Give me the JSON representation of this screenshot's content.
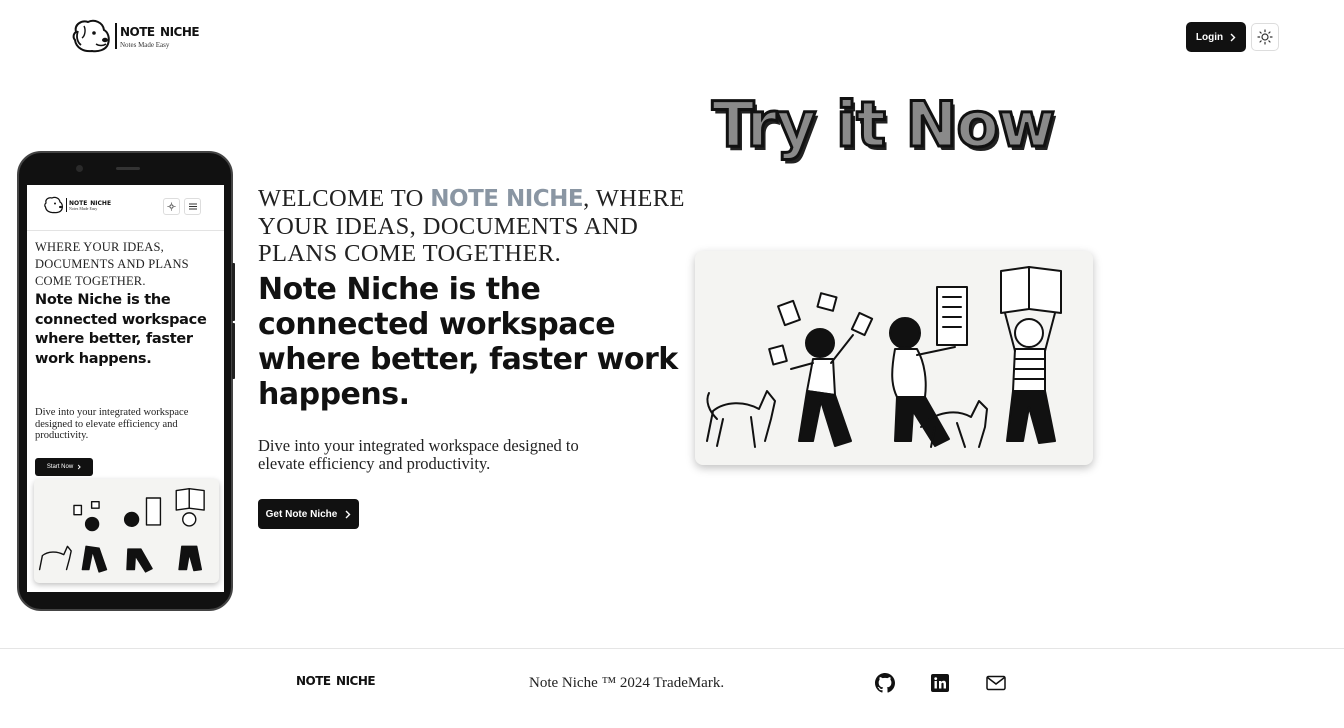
{
  "header": {
    "brand": "Note Niche",
    "tagline": "Notes Made Easy",
    "login_label": "Login",
    "theme_icon": "sun-icon"
  },
  "hero": {
    "try_now": "Try it Now",
    "welcome_prefix": "WELCOME TO",
    "welcome_brand": "NOTE NICHE",
    "welcome_suffix": ", WHERE YOUR IDEAS, DOCUMENTS AND PLANS COME TOGETHER.",
    "headline": "Note Niche is the connected workspace where better, faster work happens.",
    "description": "Dive into your integrated workspace designed to elevate efficiency and productivity.",
    "cta_label": "Get Note Niche"
  },
  "phone_preview": {
    "brand": "Note Niche",
    "tagline": "Notes Made Easy",
    "welcome": "WHERE YOUR IDEAS, DOCUMENTS AND PLANS COME TOGETHER.",
    "headline": "Note Niche is the connected workspace where better, faster work happens.",
    "description": "Dive into your integrated workspace designed to elevate efficiency and productivity.",
    "cta_label": "Start Now"
  },
  "footer": {
    "brand": "Note Niche",
    "copyright": "Note Niche ™ 2024 TradeMark.",
    "icons": [
      "github-icon",
      "linkedin-icon",
      "mail-icon"
    ]
  },
  "colors": {
    "primary": "#111111",
    "brand_accent": "#8a96a3",
    "card_bg": "#f4f4f2"
  }
}
